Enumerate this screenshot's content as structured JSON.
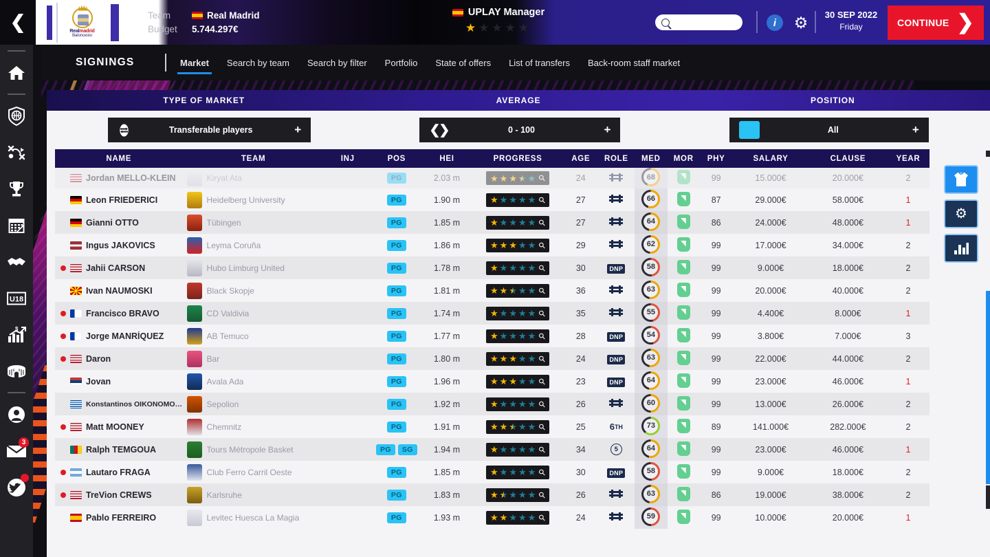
{
  "header": {
    "back_icon": "chevron-left-icon",
    "crest": {
      "line1_a": "Real",
      "line1_b": "madrid",
      "line2": "Baloncesto"
    },
    "team_label": "Team",
    "team_value": "Real Madrid",
    "budget_label": "Budget",
    "budget_value": "5.744.297€",
    "manager_name": "UPLAY Manager",
    "manager_stars_filled": 1,
    "manager_stars_total": 5,
    "search_placeholder": "",
    "search_value": "",
    "date_main": "30 SEP 2022",
    "date_sub": "Friday",
    "continue_label": "CONTINUE",
    "accent_red": "#e8152a",
    "accent_blue": "#1d8ef0"
  },
  "rail": {
    "items": [
      {
        "name": "home-icon",
        "badge": null
      },
      {
        "name": "shield-basketball-icon",
        "badge": null
      },
      {
        "name": "tactics-icon",
        "badge": null
      },
      {
        "name": "trophy-icon",
        "badge": null
      },
      {
        "name": "calendar-icon",
        "badge": null
      },
      {
        "name": "handshake-icon",
        "badge": null
      },
      {
        "name": "u18-icon",
        "badge": null
      },
      {
        "name": "finance-chart-icon",
        "badge": null
      },
      {
        "name": "stadium-icon",
        "badge": null
      },
      {
        "name": "profile-icon",
        "badge": null
      },
      {
        "name": "mail-icon",
        "badge": "3"
      },
      {
        "name": "twitter-bird-icon",
        "badge": ""
      }
    ]
  },
  "subnav": {
    "title": "SIGNINGS",
    "tabs": [
      {
        "label": "Market",
        "active": true
      },
      {
        "label": "Search by team",
        "active": false
      },
      {
        "label": "Search by filter",
        "active": false
      },
      {
        "label": "Portfolio",
        "active": false
      },
      {
        "label": "State of offers",
        "active": false
      },
      {
        "label": "List of transfers",
        "active": false
      },
      {
        "label": "Back-room staff market",
        "active": false
      }
    ]
  },
  "filters": {
    "headers": [
      "TYPE OF MARKET",
      "AVERAGE",
      "POSITION"
    ],
    "market": {
      "icon": "transfer-icon",
      "value": "Transferable players",
      "plus": "+"
    },
    "average": {
      "icon": "range-arrows-icon",
      "value": "0 - 100",
      "plus": "+"
    },
    "position": {
      "icon": "position-chip-icon",
      "value": "All",
      "plus": "+"
    }
  },
  "table": {
    "columns": [
      "NAME",
      "TEAM",
      "INJ",
      "POS",
      "HEI",
      "PROGRESS",
      "AGE",
      "ROLE",
      "MED",
      "MOR",
      "PHY",
      "SALARY",
      "CLAUSE",
      "YEAR"
    ],
    "rows": [
      {
        "partial": true,
        "dot": false,
        "flag": "us-red",
        "name": "Jordan MELLO-KLEIN",
        "team": "Kiryat Ata",
        "pos": [
          "PG"
        ],
        "hei": "2.03 m",
        "stars": 3.5,
        "age": "24",
        "role": "bench",
        "med": "68",
        "mor": "green",
        "phy": "99",
        "salary": "15.000€",
        "clause": "20.000€",
        "year": "2",
        "year_red": false
      },
      {
        "partial": false,
        "dot": false,
        "flag": "de",
        "name": "Leon FRIEDERICI",
        "team": "Heidelberg University",
        "pos": [
          "PG"
        ],
        "hei": "1.90 m",
        "stars": 1,
        "age": "27",
        "role": "bench",
        "med": "66",
        "mor": "green",
        "phy": "87",
        "salary": "29.000€",
        "clause": "58.000€",
        "year": "1",
        "year_red": true
      },
      {
        "partial": false,
        "dot": false,
        "flag": "de",
        "name": "Gianni OTTO",
        "team": "Tübingen",
        "pos": [
          "PG"
        ],
        "hei": "1.85 m",
        "stars": 1,
        "age": "27",
        "role": "bench",
        "med": "64",
        "mor": "green",
        "phy": "86",
        "salary": "24.000€",
        "clause": "48.000€",
        "year": "1",
        "year_red": true
      },
      {
        "partial": false,
        "dot": false,
        "flag": "lv",
        "name": "Ingus JAKOVICS",
        "team": "Leyma Coruña",
        "pos": [
          "PG"
        ],
        "hei": "1.86 m",
        "stars": 3,
        "age": "29",
        "role": "bench",
        "med": "62",
        "mor": "green",
        "phy": "99",
        "salary": "17.000€",
        "clause": "34.000€",
        "year": "2",
        "year_red": false
      },
      {
        "partial": false,
        "dot": true,
        "flag": "us",
        "name": "Jahii CARSON",
        "team": "Hubo Limburg United",
        "pos": [
          "PG"
        ],
        "hei": "1.78 m",
        "stars": 1,
        "age": "30",
        "role": "dnp",
        "med": "58",
        "mor": "green",
        "phy": "99",
        "salary": "9.000€",
        "clause": "18.000€",
        "year": "2",
        "year_red": false
      },
      {
        "partial": false,
        "dot": false,
        "flag": "mk",
        "name": "Ivan NAUMOSKI",
        "team": "Black Skopje",
        "pos": [
          "PG"
        ],
        "hei": "1.81 m",
        "stars": 2.5,
        "age": "36",
        "role": "bench",
        "med": "63",
        "mor": "green",
        "phy": "99",
        "salary": "20.000€",
        "clause": "40.000€",
        "year": "2",
        "year_red": false
      },
      {
        "partial": false,
        "dot": true,
        "flag": "cl",
        "name": "Francisco BRAVO",
        "team": "CD Valdivia",
        "pos": [
          "PG"
        ],
        "hei": "1.74 m",
        "stars": 1,
        "age": "35",
        "role": "bench",
        "med": "55",
        "mor": "green",
        "phy": "99",
        "salary": "4.400€",
        "clause": "8.000€",
        "year": "1",
        "year_red": true
      },
      {
        "partial": false,
        "dot": true,
        "flag": "cl",
        "name": "Jorge MANRÍQUEZ",
        "team": "AB Temuco",
        "pos": [
          "PG"
        ],
        "hei": "1.77 m",
        "stars": 1,
        "age": "28",
        "role": "dnp",
        "med": "54",
        "mor": "green",
        "phy": "99",
        "salary": "3.800€",
        "clause": "7.000€",
        "year": "3",
        "year_red": false
      },
      {
        "partial": false,
        "dot": true,
        "flag": "us",
        "name": "Daron",
        "team": "Bar",
        "pos": [
          "PG"
        ],
        "hei": "1.80 m",
        "stars": 3,
        "age": "24",
        "role": "dnp",
        "med": "63",
        "mor": "green",
        "phy": "99",
        "salary": "22.000€",
        "clause": "44.000€",
        "year": "2",
        "year_red": false
      },
      {
        "partial": false,
        "dot": false,
        "flag": "rs",
        "name": "Jovan",
        "team": "Avala Ada",
        "pos": [
          "PG"
        ],
        "hei": "1.96 m",
        "stars": 3,
        "age": "23",
        "role": "dnp",
        "med": "64",
        "mor": "green",
        "phy": "99",
        "salary": "23.000€",
        "clause": "46.000€",
        "year": "1",
        "year_red": true
      },
      {
        "partial": false,
        "dot": false,
        "flag": "gr",
        "name": "Konstantinos OIKONOMOPOULOS",
        "team": "Sepolion",
        "pos": [
          "PG"
        ],
        "hei": "1.92 m",
        "stars": 1,
        "age": "26",
        "role": "bench",
        "med": "60",
        "mor": "green",
        "phy": "99",
        "salary": "13.000€",
        "clause": "26.000€",
        "year": "2",
        "year_red": false,
        "small_name": true
      },
      {
        "partial": false,
        "dot": true,
        "flag": "us",
        "name": "Matt MOONEY",
        "team": "Chemnitz",
        "pos": [
          "PG"
        ],
        "hei": "1.91 m",
        "stars": 2.5,
        "age": "25",
        "role": "6th",
        "med": "73",
        "mor": "green",
        "phy": "89",
        "salary": "141.000€",
        "clause": "282.000€",
        "year": "2",
        "year_red": false
      },
      {
        "partial": false,
        "dot": false,
        "flag": "cm",
        "name": "Ralph TEMGOUA",
        "team": "Tours Métropole Basket",
        "pos": [
          "PG",
          "SG"
        ],
        "hei": "1.94 m",
        "stars": 1,
        "age": "34",
        "role": "num5",
        "med": "64",
        "mor": "green",
        "phy": "99",
        "salary": "23.000€",
        "clause": "46.000€",
        "year": "1",
        "year_red": true
      },
      {
        "partial": false,
        "dot": true,
        "flag": "ar",
        "name": "Lautaro FRAGA",
        "team": "Club Ferro Carril Oeste",
        "pos": [
          "PG"
        ],
        "hei": "1.85 m",
        "stars": 1,
        "age": "30",
        "role": "dnp",
        "med": "58",
        "mor": "green",
        "phy": "99",
        "salary": "9.000€",
        "clause": "18.000€",
        "year": "2",
        "year_red": false
      },
      {
        "partial": false,
        "dot": true,
        "flag": "us",
        "name": "TreVion CREWS",
        "team": "Karlsruhe",
        "pos": [
          "PG"
        ],
        "hei": "1.83 m",
        "stars": 1.5,
        "age": "26",
        "role": "bench",
        "med": "63",
        "mor": "green",
        "phy": "86",
        "salary": "19.000€",
        "clause": "38.000€",
        "year": "2",
        "year_red": false
      },
      {
        "partial": false,
        "dot": false,
        "flag": "es",
        "name": "Pablo FERREIRO",
        "team": "Levitec Huesca La Magia",
        "pos": [
          "PG"
        ],
        "hei": "1.93 m",
        "stars": 2,
        "age": "24",
        "role": "bench",
        "med": "59",
        "mor": "green",
        "phy": "99",
        "salary": "10.000€",
        "clause": "20.000€",
        "year": "1",
        "year_red": true
      }
    ]
  },
  "side_buttons": [
    {
      "name": "jersey-icon",
      "style": "blue"
    },
    {
      "name": "gear-icon",
      "style": "dark"
    },
    {
      "name": "bar-chart-icon",
      "style": "dark"
    }
  ]
}
